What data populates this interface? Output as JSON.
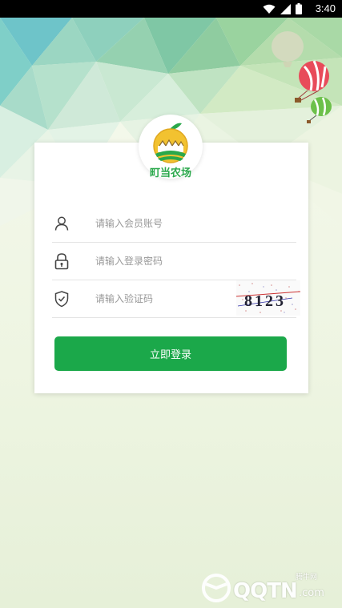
{
  "status_bar": {
    "time": "3:40",
    "icons": [
      "wifi-icon",
      "cellular-icon",
      "battery-icon"
    ]
  },
  "logo": {
    "name": "町当农场"
  },
  "form": {
    "account_placeholder": "请输入会员账号",
    "password_placeholder": "请输入登录密码",
    "captcha_placeholder": "请输入验证码",
    "captcha_code": "8123",
    "login_label": "立即登录"
  },
  "watermark": {
    "main": "QQTN",
    "small": "腾牛网",
    "suffix": ".com"
  },
  "colors": {
    "accent": "#1ba84a",
    "logo_text": "#2aa84b"
  }
}
